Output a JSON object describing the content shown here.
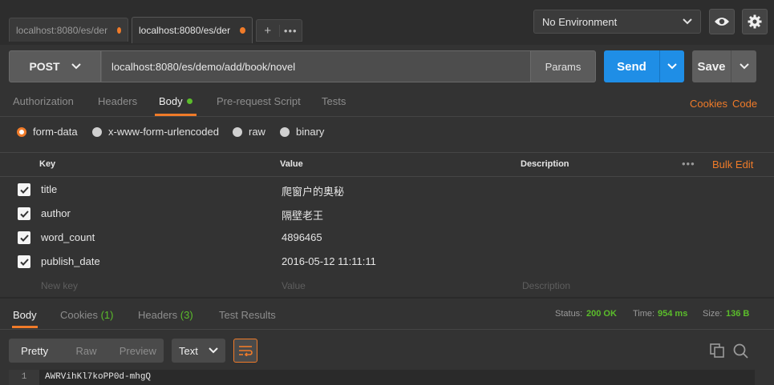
{
  "tabs": [
    {
      "label": "localhost:8080/es/der",
      "unsaved": true
    },
    {
      "label": "localhost:8080/es/der",
      "unsaved": true
    }
  ],
  "tab_actions": {
    "add": "+",
    "more": "•••"
  },
  "environment": {
    "selected": "No Environment"
  },
  "request": {
    "method": "POST",
    "url": "localhost:8080/es/demo/add/book/novel",
    "params_label": "Params",
    "send_label": "Send",
    "save_label": "Save"
  },
  "request_tabs": [
    {
      "label": "Authorization"
    },
    {
      "label": "Headers"
    },
    {
      "label": "Body",
      "active": true
    },
    {
      "label": "Pre-request Script"
    },
    {
      "label": "Tests"
    }
  ],
  "request_links": {
    "cookies": "Cookies",
    "code": "Code"
  },
  "body_modes": [
    {
      "label": "form-data",
      "selected": true
    },
    {
      "label": "x-www-form-urlencoded",
      "selected": false
    },
    {
      "label": "raw",
      "selected": false
    },
    {
      "label": "binary",
      "selected": false
    }
  ],
  "table": {
    "headers": {
      "key": "Key",
      "value": "Value",
      "description": "Description"
    },
    "bulk_edit": "Bulk Edit",
    "more": "•••",
    "rows": [
      {
        "checked": true,
        "key": "title",
        "value": "爬窗户的奥秘"
      },
      {
        "checked": true,
        "key": "author",
        "value": "隔壁老王"
      },
      {
        "checked": true,
        "key": "word_count",
        "value": "4896465"
      },
      {
        "checked": true,
        "key": "publish_date",
        "value": "2016-05-12 11:11:11"
      }
    ],
    "placeholders": {
      "key": "New key",
      "value": "Value",
      "description": "Description"
    }
  },
  "response_tabs": [
    {
      "label": "Body",
      "count": "",
      "active": true
    },
    {
      "label": "Cookies",
      "count": "(1)"
    },
    {
      "label": "Headers",
      "count": "(3)"
    },
    {
      "label": "Test Results",
      "count": ""
    }
  ],
  "response_stats": {
    "status_label": "Status:",
    "status_value": "200 OK",
    "time_label": "Time:",
    "time_value": "954 ms",
    "size_label": "Size:",
    "size_value": "136 B"
  },
  "view_modes": [
    {
      "label": "Pretty",
      "active": true
    },
    {
      "label": "Raw"
    },
    {
      "label": "Preview"
    }
  ],
  "format": {
    "selected": "Text"
  },
  "response_body": {
    "line_number": "1",
    "text": "AWRVihKl7koPP0d-mhgQ"
  },
  "colors": {
    "accent": "#f07b29",
    "send": "#1f8ee6",
    "success": "#5bbd2b"
  }
}
